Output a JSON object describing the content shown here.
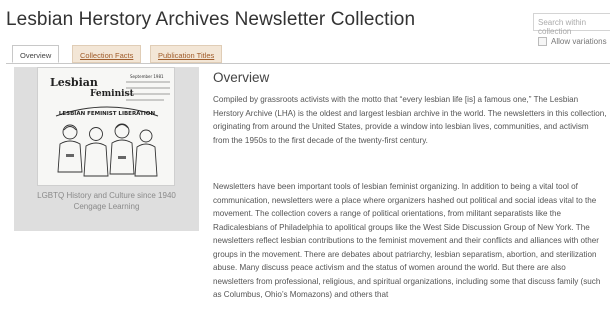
{
  "header": {
    "title": "Lesbian Herstory Archives Newsletter Collection",
    "search_placeholder": "Search within collection",
    "allow_variations": "Allow variations"
  },
  "tabs": [
    {
      "label": "Overview",
      "active": true
    },
    {
      "label": "Collection Facts",
      "active": false
    },
    {
      "label": "Publication Titles",
      "active": false
    }
  ],
  "image_panel": {
    "caption_line1": "LGBTQ History and Culture since 1940",
    "caption_line2": "Cengage Learning",
    "cover_masthead_top": "Lesbian",
    "cover_masthead_mid": "Feminist",
    "cover_date": "September 1981",
    "cover_banner": "LESBIAN FEMINIST LIBERATION"
  },
  "overview": {
    "heading": "Overview",
    "para1": "Compiled by grassroots activists with the motto that “every lesbian life [is] a famous one,” The Lesbian Herstory Archive (LHA) is the oldest and largest lesbian archive in the world. The newsletters in this collection, originating from around the United States, provide a window into lesbian lives, communities, and activism from the 1950s to the first decade of the twenty-first century.",
    "para2": "Newsletters have been important tools of lesbian feminist organizing. In addition to being a vital tool of communication, newsletters were a place where organizers hashed out political and social ideas vital to the movement. The collection covers a range of political orientations, from militant separatists like the Radicalesbians of Philadelphia to apolitical groups like the West Side Discussion Group of New York. The newsletters reflect lesbian contributions to the feminist movement and their conflicts and alliances with other groups in the movement. There are debates about patriarchy, lesbian separatism, abortion, and sterilization abuse. Many discuss peace activism and the status of women around the world. But there are also newsletters from professional, religious, and spiritual organizations, including some that discuss family (such as Columbus, Ohio’s Momazons) and others that"
  },
  "colors": {
    "tab_link_bg": "#f3e6d6",
    "tab_link_text": "#a05c2a",
    "panel_bg": "#dedede"
  }
}
